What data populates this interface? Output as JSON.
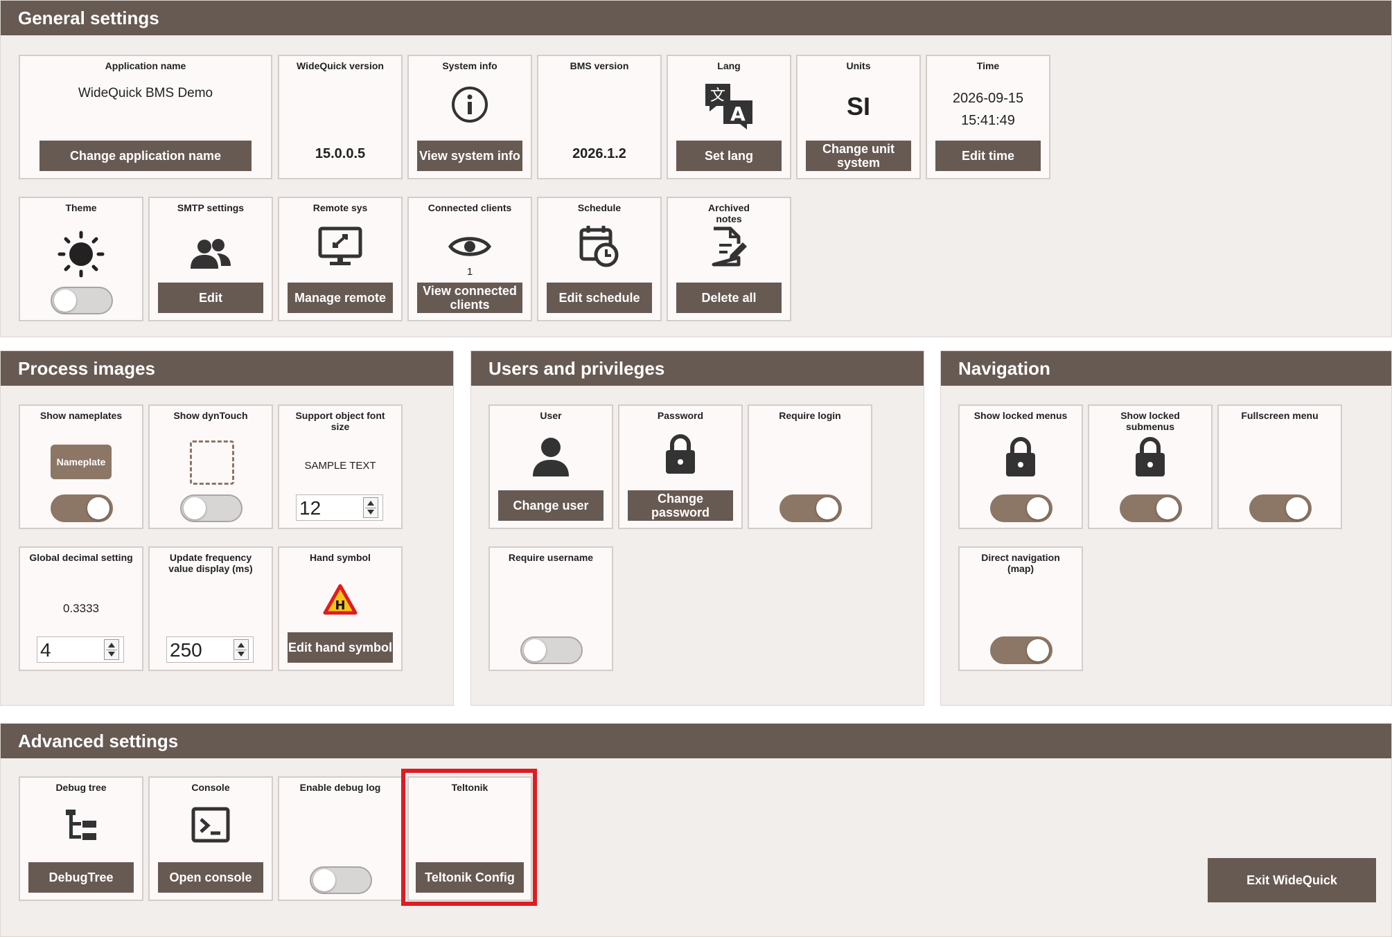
{
  "general": {
    "title": "General settings",
    "app_name": {
      "title": "Application name",
      "value": "WideQuick BMS Demo",
      "button": "Change application name"
    },
    "wq_version": {
      "title": "WideQuick version",
      "value": "15.0.0.5"
    },
    "system_info": {
      "title": "System info",
      "button": "View system info"
    },
    "bms_version": {
      "title": "BMS version",
      "value": "2026.1.2"
    },
    "lang": {
      "title": "Lang",
      "button": "Set lang"
    },
    "units": {
      "title": "Units",
      "value": "SI",
      "button": "Change unit system"
    },
    "time": {
      "title": "Time",
      "date": "2026-09-15",
      "clock": "15:41:49",
      "button": "Edit time"
    },
    "theme": {
      "title": "Theme",
      "toggle": false
    },
    "smtp": {
      "title": "SMTP settings",
      "button": "Edit"
    },
    "remote": {
      "title": "Remote sys",
      "button": "Manage remote"
    },
    "clients": {
      "title": "Connected clients",
      "count": "1",
      "button": "View connected clients"
    },
    "schedule": {
      "title": "Schedule",
      "button": "Edit schedule"
    },
    "notes": {
      "title": "Archived notes",
      "button": "Delete all"
    }
  },
  "process": {
    "title": "Process images",
    "nameplates": {
      "title": "Show nameplates",
      "sample": "Nameplate",
      "toggle": true
    },
    "dyntouch": {
      "title": "Show dynTouch",
      "toggle": false
    },
    "font_size": {
      "title": "Support object font size",
      "sample": "SAMPLE TEXT",
      "value": "12"
    },
    "decimal": {
      "title": "Global decimal setting",
      "sample": "0.3333",
      "value": "4"
    },
    "update_freq": {
      "title": "Update frequency value display (ms)",
      "value": "250"
    },
    "hand": {
      "title": "Hand symbol",
      "badge": "H",
      "button": "Edit hand symbol"
    }
  },
  "users": {
    "title": "Users and privileges",
    "user": {
      "title": "User",
      "button": "Change user"
    },
    "password": {
      "title": "Password",
      "button": "Change password"
    },
    "require_login": {
      "title": "Require login",
      "toggle": true
    },
    "require_username": {
      "title": "Require username",
      "toggle": false
    }
  },
  "navigation": {
    "title": "Navigation",
    "locked_menus": {
      "title": "Show locked menus",
      "toggle": true
    },
    "locked_submenus": {
      "title": "Show locked submenus",
      "toggle": true
    },
    "fullscreen": {
      "title": "Fullscreen menu",
      "toggle": true
    },
    "direct_nav": {
      "title": "Direct navigation (map)",
      "toggle": true
    }
  },
  "advanced": {
    "title": "Advanced settings",
    "debug_tree": {
      "title": "Debug tree",
      "button": "DebugTree"
    },
    "console": {
      "title": "Console",
      "button": "Open console"
    },
    "debug_log": {
      "title": "Enable debug log",
      "toggle": false
    },
    "teltonik": {
      "title": "Teltonik",
      "button": "Teltonik Config"
    }
  },
  "exit_button": "Exit WideQuick",
  "colors": {
    "header": "#675a53",
    "accent": "#8c7665",
    "highlight": "#e01b22",
    "background": "#f1eeec"
  },
  "icons": [
    "info-icon",
    "translate-icon",
    "sun-icon",
    "users-icon",
    "remote-desktop-icon",
    "eye-icon",
    "calendar-clock-icon",
    "document-edit-icon",
    "dashed-box-icon",
    "hand-warning-icon",
    "user-icon",
    "lock-icon",
    "tree-icon",
    "console-icon"
  ]
}
